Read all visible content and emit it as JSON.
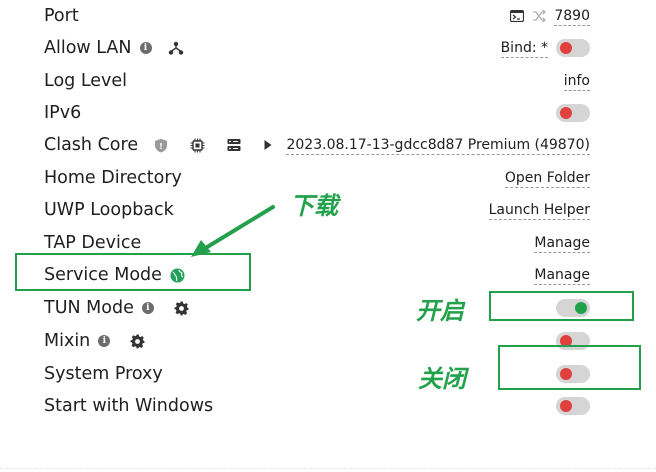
{
  "rows": {
    "port": {
      "label": "Port",
      "value": "7890",
      "terminal_icon": "terminal-icon",
      "shuffle_icon": "shuffle-icon"
    },
    "allow_lan": {
      "label": "Allow LAN",
      "bind": "Bind: *",
      "toggle": "off",
      "network_icon": "network-icon"
    },
    "log_level": {
      "label": "Log Level",
      "value": "info"
    },
    "ipv6": {
      "label": "IPv6",
      "toggle": "off"
    },
    "clash_core": {
      "label": "Clash Core",
      "version": "2023.08.17-13-gdcc8d87 Premium (49870)"
    },
    "home_directory": {
      "label": "Home Directory",
      "action": "Open Folder"
    },
    "uwp_loopback": {
      "label": "UWP Loopback",
      "action": "Launch Helper"
    },
    "tap_device": {
      "label": "TAP Device",
      "action": "Manage"
    },
    "service_mode": {
      "label": "Service Mode",
      "action": "Manage",
      "status_color": "#25a05a"
    },
    "tun_mode": {
      "label": "TUN Mode",
      "toggle": "on"
    },
    "mixin": {
      "label": "Mixin",
      "toggle": "off"
    },
    "system_proxy": {
      "label": "System Proxy",
      "toggle": "off"
    },
    "start_with_windows": {
      "label": "Start with Windows",
      "toggle": "off"
    }
  },
  "annotations": {
    "download": "下载",
    "enable": "开启",
    "disable": "关闭"
  },
  "colors": {
    "accent_green": "#24a04c",
    "toggle_off_knob": "#e0413f",
    "toggle_on_knob": "#21a14a",
    "toggle_track": "#d5d5d5"
  }
}
